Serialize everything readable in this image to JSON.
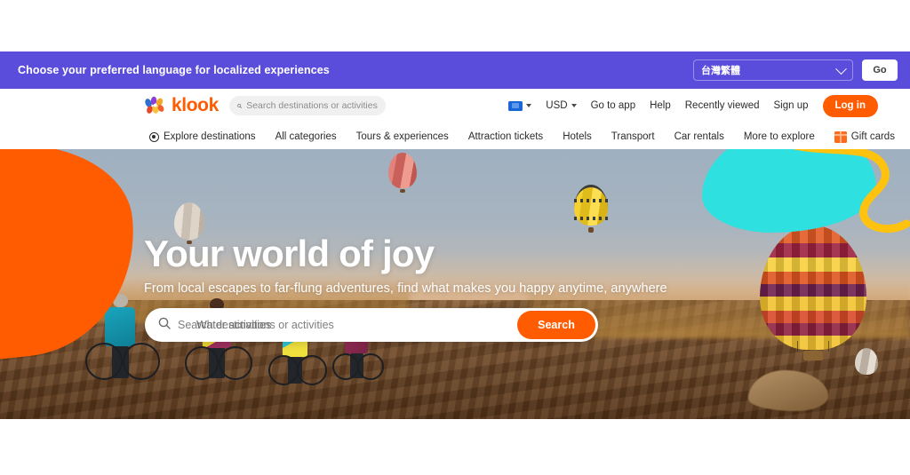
{
  "language_banner": {
    "message": "Choose your preferred language for localized experiences",
    "selected_language": "台灣繁體",
    "go_label": "Go",
    "chevron_icon": "chevron-down-icon",
    "background_color": "#5b4ddb"
  },
  "header": {
    "logo_text": "klook",
    "logo_color": "#ff5b00",
    "search_placeholder": "Search destinations or activities",
    "search_icon": "search-icon",
    "region_icon": "flag-icon",
    "currency": "USD",
    "links": [
      {
        "label": "Go to app"
      },
      {
        "label": "Help"
      },
      {
        "label": "Recently viewed"
      },
      {
        "label": "Sign up"
      }
    ],
    "login_label": "Log in"
  },
  "category_nav": {
    "items": [
      {
        "label": "Explore destinations",
        "icon": "location-pin-icon"
      },
      {
        "label": "All categories",
        "icon": ""
      },
      {
        "label": "Tours & experiences",
        "icon": ""
      },
      {
        "label": "Attraction tickets",
        "icon": ""
      },
      {
        "label": "Hotels",
        "icon": ""
      },
      {
        "label": "Transport",
        "icon": ""
      },
      {
        "label": "Car rentals",
        "icon": ""
      },
      {
        "label": "More to explore",
        "icon": ""
      },
      {
        "label": "Gift cards",
        "icon": "gift-icon"
      }
    ]
  },
  "hero": {
    "title": "Your world of joy",
    "subtitle": "From local escapes to far-flung adventures, find what makes you happy anytime, anywhere",
    "search_placeholder_primary": "Search destinations or activities",
    "search_placeholder_secondary": "Water activities",
    "search_icon": "search-icon",
    "search_button_label": "Search",
    "accent_color": "#ff5b00",
    "decor": {
      "orange_blob_color": "#ff5b00",
      "cyan_blob_color": "#2fe0e0",
      "yellow_squiggle_color": "#ffc20e"
    }
  }
}
